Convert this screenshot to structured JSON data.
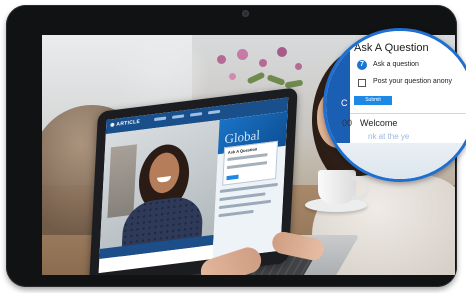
{
  "zoom_panel": {
    "title": "Ask A Question",
    "option_icon": "7",
    "option_ask": "Ask a question",
    "option_post": "Post your question anony",
    "submit_label": "Submit",
    "sidebar_letter": "C",
    "agenda_time": "00",
    "agenda_item": "Welcome",
    "agenda_faded": "nk at the ye"
  },
  "laptop_page": {
    "logo": "◉ ARTICLE",
    "banner_text": "Global",
    "mini_card_title": "Ask A Question"
  },
  "icons": [
    "camera-icon",
    "question-mark-icon",
    "checkbox-icon"
  ],
  "colors": {
    "brand_blue": "#1a5fb4",
    "button_blue": "#1e88e5",
    "zoom_ring": "#1f6fd1"
  }
}
